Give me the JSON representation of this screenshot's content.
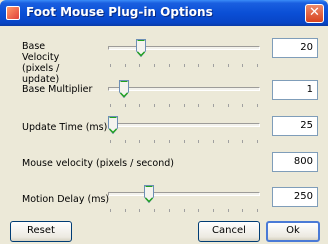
{
  "window": {
    "title": "Foot Mouse Plug-in Options",
    "close_glyph": "✕",
    "icon": "app-icon"
  },
  "rows": [
    {
      "label": "Base Velocity (pixels / update)",
      "value": "20",
      "slider_level": 0.2
    },
    {
      "label": "Base Multiplier",
      "value": "1",
      "slider_level": 0.08
    },
    {
      "label": "Update Time (ms)",
      "value": "25",
      "slider_level": 0.0
    },
    {
      "label": "Mouse velocity (pixels / second)",
      "value": "800"
    },
    {
      "label": "Motion Delay (ms)",
      "value": "250",
      "slider_level": 0.25
    }
  ],
  "buttons": {
    "reset": "Reset",
    "cancel": "Cancel",
    "ok": "Ok"
  },
  "colors": {
    "titlebar": "#0a4fd6",
    "window_bg": "#ece9d8",
    "close": "#d8431f",
    "thumb_accent": "#21a121"
  }
}
